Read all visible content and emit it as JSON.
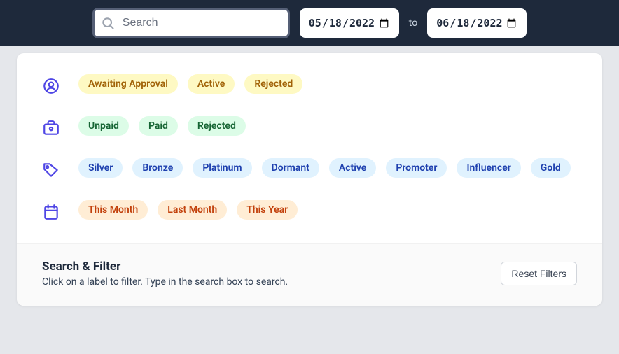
{
  "header": {
    "search_placeholder": "Search",
    "date_from": "2022-05-18",
    "date_to": "2022-06-18",
    "to_label": "to"
  },
  "filters": {
    "approval": [
      "Awaiting Approval",
      "Active",
      "Rejected"
    ],
    "payment": [
      "Unpaid",
      "Paid",
      "Rejected"
    ],
    "tags": [
      "Silver",
      "Bronze",
      "Platinum",
      "Dormant",
      "Active",
      "Promoter",
      "Influencer",
      "Gold"
    ],
    "dates": [
      "This Month",
      "Last Month",
      "This Year"
    ]
  },
  "footer": {
    "title": "Search & Filter",
    "subtitle": "Click on a label to filter. Type in the search box to search.",
    "reset_label": "Reset Filters"
  }
}
